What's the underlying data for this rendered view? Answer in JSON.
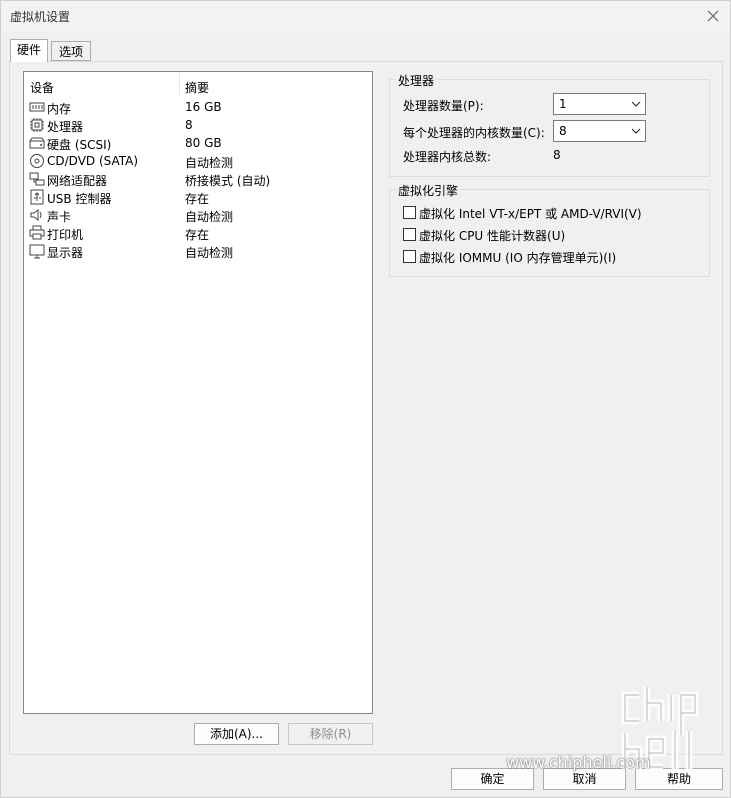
{
  "window": {
    "title": "虚拟机设置"
  },
  "tabs": [
    {
      "label": "硬件"
    },
    {
      "label": "选项"
    }
  ],
  "device_list": {
    "columns": {
      "device": "设备",
      "summary": "摘要"
    },
    "rows": [
      {
        "name": "内存",
        "summary": "16 GB",
        "icon": "memory-icon"
      },
      {
        "name": "处理器",
        "summary": "8",
        "icon": "processor-icon"
      },
      {
        "name": "硬盘 (SCSI)",
        "summary": "80 GB",
        "icon": "hard-disk-icon"
      },
      {
        "name": "CD/DVD (SATA)",
        "summary": "自动检测",
        "icon": "cd-dvd-icon"
      },
      {
        "name": "网络适配器",
        "summary": "桥接模式 (自动)",
        "icon": "network-adapter-icon"
      },
      {
        "name": "USB 控制器",
        "summary": "存在",
        "icon": "usb-icon"
      },
      {
        "name": "声卡",
        "summary": "自动检测",
        "icon": "sound-card-icon"
      },
      {
        "name": "打印机",
        "summary": "存在",
        "icon": "printer-icon"
      },
      {
        "name": "显示器",
        "summary": "自动检测",
        "icon": "display-icon"
      }
    ]
  },
  "buttons": {
    "add": "添加(A)...",
    "remove": "移除(R)",
    "ok": "确定",
    "cancel": "取消",
    "help": "帮助"
  },
  "processor": {
    "title": "处理器",
    "count_label": "处理器数量(P):",
    "count_value": "1",
    "cores_label": "每个处理器的内核数量(C):",
    "cores_value": "8",
    "total_label": "处理器内核总数:",
    "total_value": "8"
  },
  "virtualization": {
    "title": "虚拟化引擎",
    "options": [
      {
        "label": "虚拟化 Intel VT-x/EPT 或 AMD-V/RVI(V)",
        "checked": false
      },
      {
        "label": "虚拟化 CPU 性能计数器(U)",
        "checked": false
      },
      {
        "label": "虚拟化 IOMMU (IO 内存管理单元)(I)",
        "checked": false
      }
    ]
  },
  "watermark": {
    "url": "www.chiphell.com",
    "logo_text": "chip hell"
  }
}
